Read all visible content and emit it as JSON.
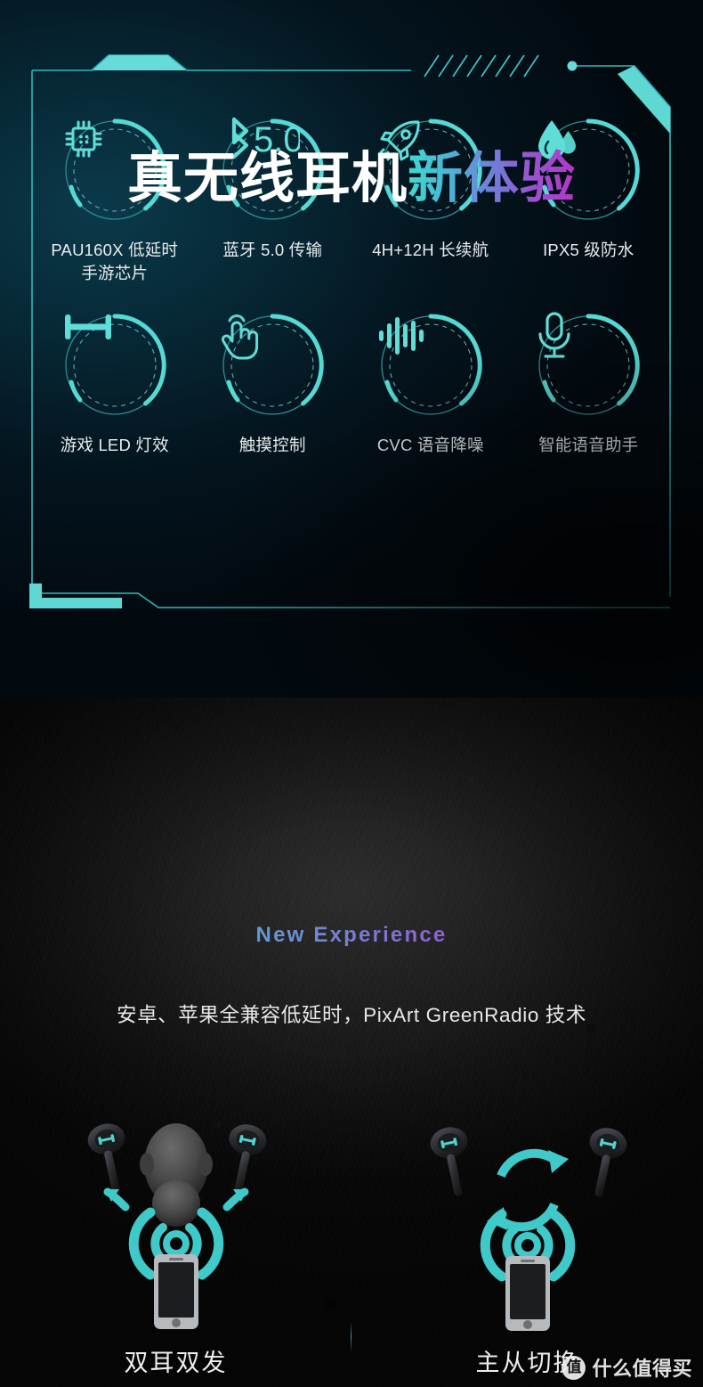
{
  "colors": {
    "accent_cyan": "#53d6d2",
    "accent_cyan_bright": "#5fe0db",
    "frame_line": "#2fb9bd",
    "headline_white": "#ffffff",
    "gradient_start": "#3fd9d0",
    "gradient_end": "#b536c6",
    "top_bg": "#072a38",
    "bottom_bg": "#141414"
  },
  "top_section": {
    "frame": {
      "hatch_marks": 8,
      "decor_names": [
        "top-left-notch",
        "top-right-dot",
        "top-right-bevel",
        "bottom-left-bracket",
        "diagonal-hatches"
      ]
    },
    "features": [
      {
        "icon": "chip-icon",
        "label": "PAU160X 低延时\n手游芯片"
      },
      {
        "icon": "bluetooth-icon",
        "label": "蓝牙 5.0 传输",
        "icon_text": "5.0"
      },
      {
        "icon": "rocket-icon",
        "label": "4H+12H 长续航"
      },
      {
        "icon": "water-drop-icon",
        "label": "IPX5 级防水"
      },
      {
        "icon": "led-bar-icon",
        "label": "游戏 LED 灯效"
      },
      {
        "icon": "touch-hand-icon",
        "label": "触摸控制"
      },
      {
        "icon": "waveform-icon",
        "label": "CVC 语音降噪"
      },
      {
        "icon": "microphone-icon",
        "label": "智能语音助手"
      }
    ]
  },
  "bottom_section": {
    "headline_white": "真无线耳机",
    "headline_gradient": "新体验",
    "subline": "New Experience",
    "tagline": "安卓、苹果全兼容低延时，PixArt GreenRadio 技术",
    "illustrations": [
      {
        "caption": "双耳双发",
        "art": "head-two-earbuds-phone-signal"
      },
      {
        "caption": "主从切换",
        "art": "two-earbuds-swap-arrows-phone-signal"
      }
    ]
  },
  "watermark": {
    "logo_char": "值",
    "text": "什么值得买"
  }
}
